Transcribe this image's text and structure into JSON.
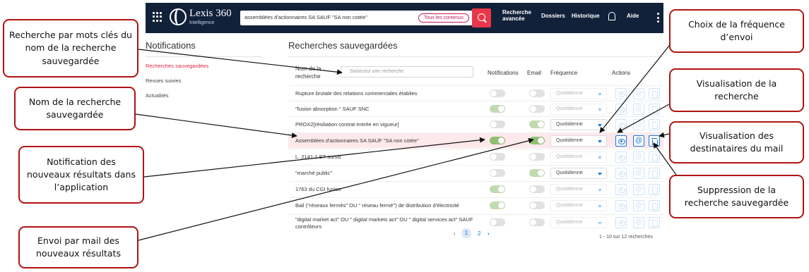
{
  "topbar": {
    "logo_name": "Lexis 360",
    "logo_sub": "Intelligence",
    "search_value": "assemblées d'actionnaires SA SAUF \"SA non cotée\"",
    "scope_label": "Tous les contenus",
    "nav": {
      "advanced_line1": "Recherche",
      "advanced_line2": "avancée",
      "folders": "Dossiers",
      "history": "Historique",
      "help": "Aide"
    }
  },
  "sidebar": {
    "title": "Notifications",
    "items": [
      {
        "label": "Recherches sauvegardées"
      },
      {
        "label": "Revues suivies"
      },
      {
        "label": "Actualités"
      }
    ]
  },
  "main": {
    "title": "Recherches sauvegardées",
    "headers": {
      "name_line1": "Nom de la",
      "name_line2": "recherche",
      "filter_placeholder": "Saisissez une recherche",
      "notifications": "Notifications",
      "email": "Email",
      "frequency": "Fréquence",
      "actions": "Actions"
    },
    "rows": [
      {
        "name": "Rupture brutale des relations commerciales établies",
        "notif": false,
        "email": false,
        "freq": "Quotidienne"
      },
      {
        "name": "\"fusion absorption \" SAUF SNC",
        "notif": true,
        "email": false,
        "freq": "Quotidienne"
      },
      {
        "name": "PROX2[résiliation contrat entrée en vigueur]",
        "notif": false,
        "email": true,
        "freq": "Quotidienne"
      },
      {
        "name": "Assemblées d'actionnaires SA SAUF \"SA non cotée\"",
        "notif": true,
        "email": true,
        "freq": "Quotidienne"
      },
      {
        "name": "L. 2141-1 ET sursis",
        "notif": false,
        "email": false,
        "freq": "Quotidienne"
      },
      {
        "name": "\"marché public\"",
        "notif": false,
        "email": true,
        "freq": "Quotidienne"
      },
      {
        "name": "1763 du CGI fusion",
        "notif": true,
        "email": false,
        "freq": "Quotidienne"
      },
      {
        "name": "Bail (\"réseaux fermés\" OU \" réseau fermé\") de distribution d'électricité",
        "notif": true,
        "email": false,
        "freq": "Quotidienne"
      },
      {
        "name": "\"digital market act\" OU \" digital markets act\" OU \" digital services act\" SAUF contrôleurs",
        "notif": false,
        "email": false,
        "freq": "Quotidienne"
      }
    ],
    "pagination": {
      "prev": "‹",
      "page1": "1",
      "page2": "2",
      "next": "›",
      "count": "1 - 10 sur 12 recherches"
    }
  },
  "callouts": {
    "keyword_search": "Recherche par mots clés du nom de la recherche sauvegardée",
    "search_name": "Nom de la recherche sauvegardée",
    "app_notification": "Notification des nouveaux résultats dans l’application",
    "email_send": "Envoi par mail des nouveaux résultats",
    "frequency": "Choix de la fréquence d’envoi",
    "view_search": "Visualisation de la recherche",
    "view_recipients": "Visualisation des destinataires du mail",
    "delete_search": "Suppression de la recherche sauvegardée"
  },
  "colors": {
    "topbar": "#12213a",
    "accent_red": "#e3263f",
    "toggle_on": "#8fbf72",
    "action_blue": "#1976d2",
    "callout_border": "#b01313",
    "highlight_row": "#fde9ec"
  },
  "icons": [
    "apps-grid-icon",
    "lexis-logo-icon",
    "search-icon",
    "bell-icon",
    "kebab-menu-icon",
    "eye-icon",
    "at-sign-icon",
    "trash-icon",
    "chevron-down-icon"
  ]
}
